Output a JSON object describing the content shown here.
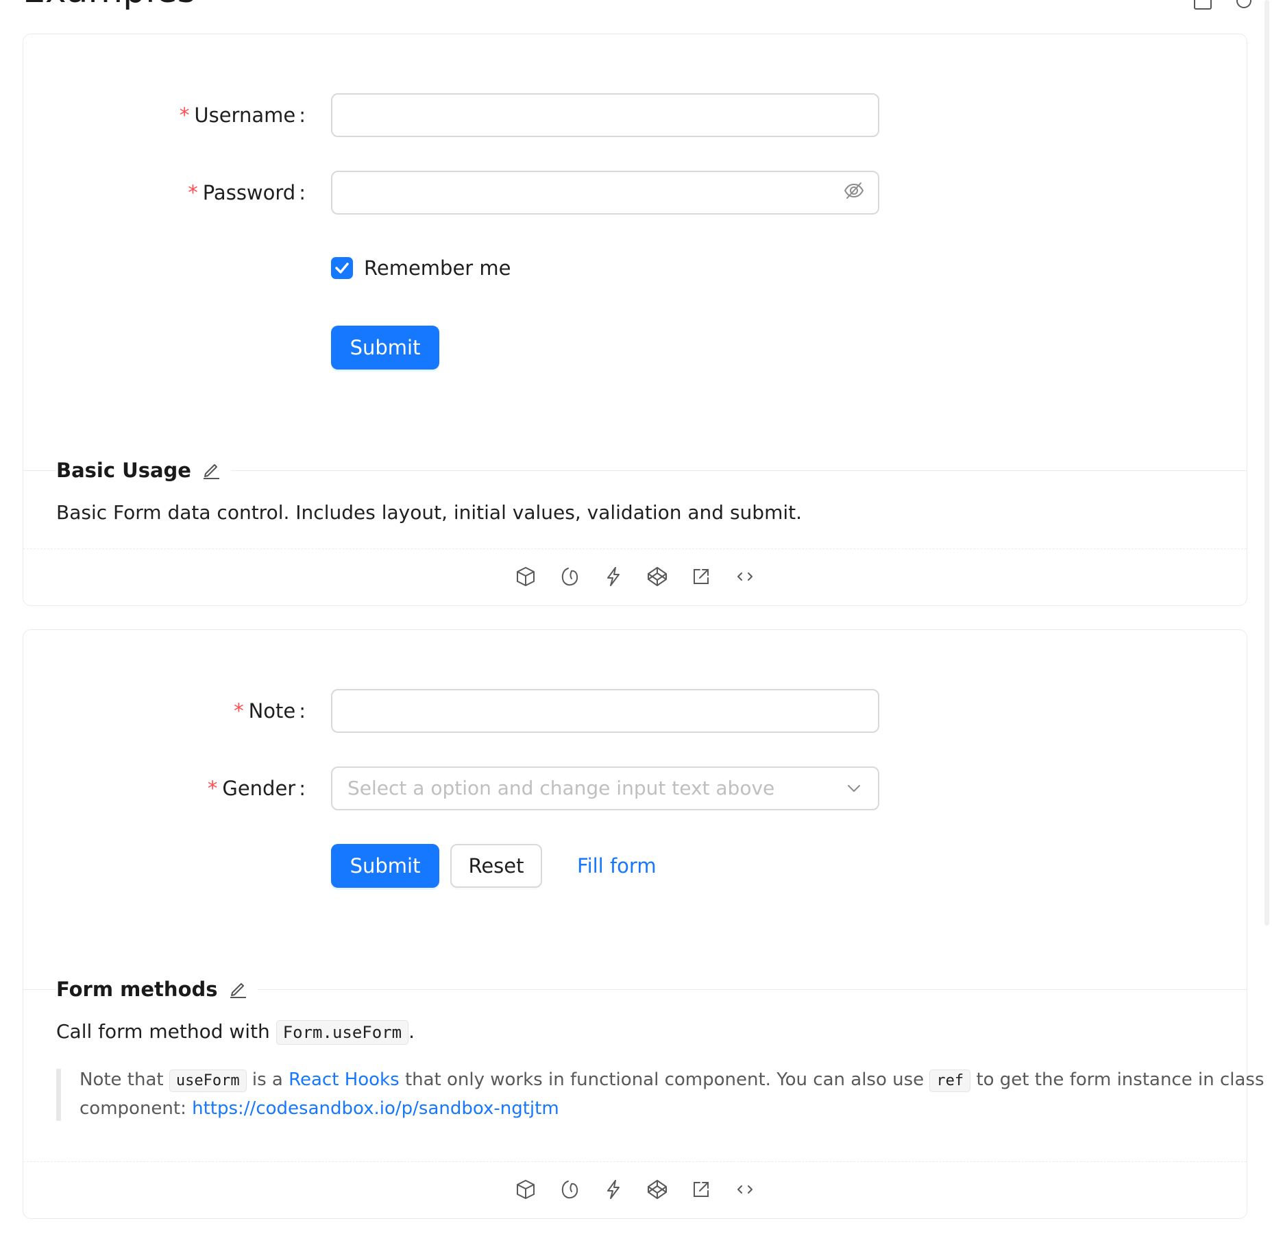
{
  "page": {
    "heading": "Examples"
  },
  "card1": {
    "form": {
      "username": {
        "label": "Username",
        "colon": ":",
        "required_mark": "*",
        "value": ""
      },
      "password": {
        "label": "Password",
        "colon": ":",
        "required_mark": "*",
        "value": "",
        "toggle_icon": "eye-invisible-icon"
      },
      "remember": {
        "label": "Remember me",
        "checked": true
      },
      "submit_label": "Submit"
    },
    "section_title": "Basic Usage",
    "description": "Basic Form data control. Includes layout, initial values, validation and submit.",
    "actions": [
      "codesandbox-icon",
      "stackblitz-icon",
      "thunderbolt-icon",
      "codepen-icon",
      "open-external-icon",
      "code-expand-icon"
    ]
  },
  "card2": {
    "form": {
      "note": {
        "label": "Note",
        "colon": ":",
        "required_mark": "*",
        "value": ""
      },
      "gender": {
        "label": "Gender",
        "colon": ":",
        "required_mark": "*",
        "placeholder": "Select a option and change input text above"
      },
      "submit_label": "Submit",
      "reset_label": "Reset",
      "fill_label": "Fill form"
    },
    "section_title": "Form methods",
    "description": {
      "before": "Call form method with",
      "code": "Form.useForm",
      "after": "."
    },
    "note": {
      "part1": "Note that",
      "code1": "useForm",
      "part2": "is a",
      "link1": "React Hooks",
      "part3": "that only works in functional component. You can also use",
      "code2": "ref",
      "part4": "to get the form instance in class",
      "part5": "component:",
      "link2": "https://codesandbox.io/p/sandbox-ngtjtm"
    },
    "actions": [
      "codesandbox-icon",
      "stackblitz-icon",
      "thunderbolt-icon",
      "codepen-icon",
      "open-external-icon",
      "code-expand-icon"
    ]
  },
  "colors": {
    "primary": "#1677ff",
    "required": "#ff4d4f",
    "border": "#d9d9d9",
    "placeholder": "#bfbfbf"
  }
}
